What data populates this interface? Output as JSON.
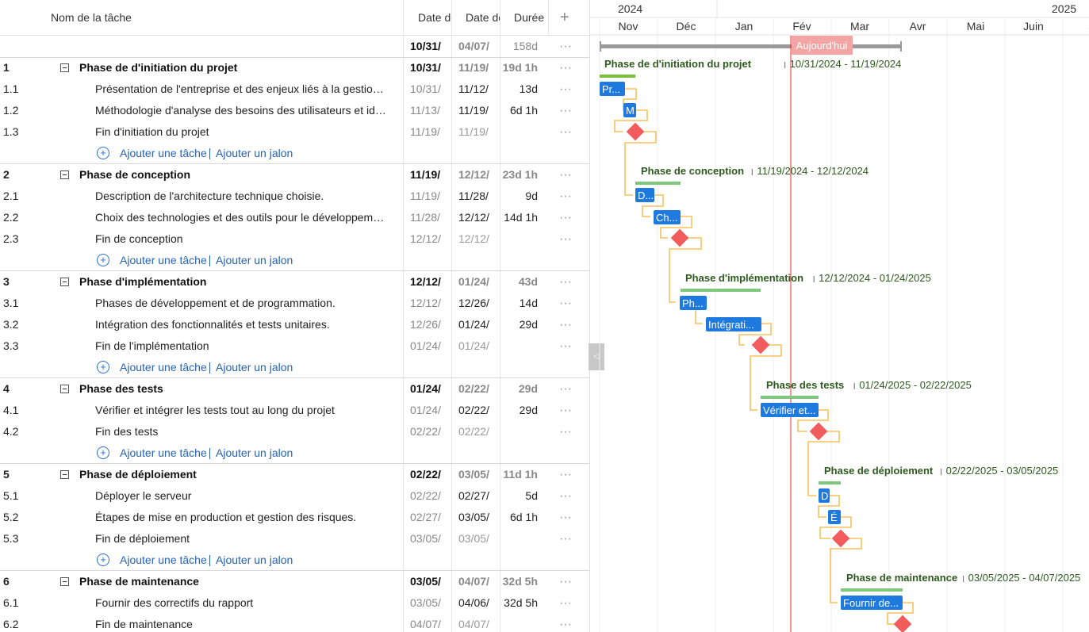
{
  "grid": {
    "headers": {
      "name": "Nom de la tâche",
      "start": "Date de",
      "end": "Date de",
      "duration": "Durée",
      "add": "+"
    },
    "summary": {
      "start": "10/31/",
      "end": "04/07/",
      "duration": "158d",
      "more": "···"
    },
    "add_task": "Ajouter une tâche",
    "add_milestone": "Ajouter un jalon",
    "more": "···",
    "rows": [
      {
        "type": "group",
        "wbs": "1",
        "name": "Phase de d'initiation du projet",
        "start": "10/31/",
        "end": "11/19/",
        "duration": "19d 1h"
      },
      {
        "type": "task",
        "wbs": "1.1",
        "name": "Présentation de l'entreprise et des enjeux liés à la gestion d...",
        "start": "10/31/",
        "end": "11/12/",
        "duration": "13d"
      },
      {
        "type": "task",
        "wbs": "1.2",
        "name": "Méthodologie d'analyse des besoins des utilisateurs et iden...",
        "start": "11/13/",
        "end": "11/19/",
        "duration": "6d 1h"
      },
      {
        "type": "task",
        "wbs": "1.3",
        "name": "Fin d'initiation du projet",
        "start": "11/19/",
        "end": "11/19/",
        "duration": ""
      },
      {
        "type": "add"
      },
      {
        "type": "group",
        "wbs": "2",
        "name": "Phase de conception",
        "start": "11/19/",
        "end": "12/12/",
        "duration": "23d 1h"
      },
      {
        "type": "task",
        "wbs": "2.1",
        "name": "Description de l'architecture technique choisie.",
        "start": "11/19/",
        "end": "11/28/",
        "duration": "9d"
      },
      {
        "type": "task",
        "wbs": "2.2",
        "name": "Choix des technologies et des outils pour le développement.",
        "start": "11/28/",
        "end": "12/12/",
        "duration": "14d 1h"
      },
      {
        "type": "task",
        "wbs": "2.3",
        "name": "Fin de conception",
        "start": "12/12/",
        "end": "12/12/",
        "duration": ""
      },
      {
        "type": "add"
      },
      {
        "type": "group",
        "wbs": "3",
        "name": "Phase d'implémentation",
        "start": "12/12/",
        "end": "01/24/",
        "duration": "43d"
      },
      {
        "type": "task",
        "wbs": "3.1",
        "name": "Phases de développement et de programmation.",
        "start": "12/12/",
        "end": "12/26/",
        "duration": "14d"
      },
      {
        "type": "task",
        "wbs": "3.2",
        "name": "Intégration des fonctionnalités et tests unitaires.",
        "start": "12/26/",
        "end": "01/24/",
        "duration": "29d"
      },
      {
        "type": "task",
        "wbs": "3.3",
        "name": "Fin de l'implémentation",
        "start": "01/24/",
        "end": "01/24/",
        "duration": ""
      },
      {
        "type": "add"
      },
      {
        "type": "group",
        "wbs": "4",
        "name": "Phase des tests",
        "start": "01/24/",
        "end": "02/22/",
        "duration": "29d"
      },
      {
        "type": "task",
        "wbs": "4.1",
        "name": "Vérifier et intégrer les tests tout au long du projet",
        "start": "01/24/",
        "end": "02/22/",
        "duration": "29d"
      },
      {
        "type": "task",
        "wbs": "4.2",
        "name": "Fin des tests",
        "start": "02/22/",
        "end": "02/22/",
        "duration": ""
      },
      {
        "type": "add"
      },
      {
        "type": "group",
        "wbs": "5",
        "name": "Phase de déploiement",
        "start": "02/22/",
        "end": "03/05/",
        "duration": "11d 1h"
      },
      {
        "type": "task",
        "wbs": "5.1",
        "name": "Déployer le serveur",
        "start": "02/22/",
        "end": "02/27/",
        "duration": "5d"
      },
      {
        "type": "task",
        "wbs": "5.2",
        "name": "Étapes de mise en production et gestion des risques.",
        "start": "02/27/",
        "end": "03/05/",
        "duration": "6d 1h"
      },
      {
        "type": "task",
        "wbs": "5.3",
        "name": "Fin de déploiement",
        "start": "03/05/",
        "end": "03/05/",
        "duration": ""
      },
      {
        "type": "add"
      },
      {
        "type": "group",
        "wbs": "6",
        "name": "Phase de maintenance",
        "start": "03/05/",
        "end": "04/07/",
        "duration": "32d 5h"
      },
      {
        "type": "task",
        "wbs": "6.1",
        "name": "Fournir des correctifs du rapport",
        "start": "03/05/",
        "end": "04/06/",
        "duration": "32d 5h"
      },
      {
        "type": "task",
        "wbs": "6.2",
        "name": "Fin de maintenance",
        "start": "04/07/",
        "end": "04/07/",
        "duration": ""
      }
    ]
  },
  "timeline": {
    "years": [
      "2024",
      "2025"
    ],
    "months": [
      "Nov",
      "Déc",
      "Jan",
      "Fév",
      "Mar",
      "Avr",
      "Mai",
      "Juin",
      "J"
    ],
    "today_label": "Aujourd'hui",
    "groups": [
      {
        "label": "Phase de d'initiation du projet",
        "range": "10/31/2024 - 11/19/2024"
      },
      {
        "label": "Phase de conception",
        "range": "11/19/2024 - 12/12/2024"
      },
      {
        "label": "Phase d'implémentation",
        "range": "12/12/2024 - 01/24/2025"
      },
      {
        "label": "Phase des tests",
        "range": "01/24/2025 - 02/22/2025"
      },
      {
        "label": "Phase de déploiement",
        "range": "02/22/2025 - 03/05/2025"
      },
      {
        "label": "Phase de maintenance",
        "range": "03/05/2025 - 04/07/2025"
      }
    ],
    "bar_labels": [
      "Pr...",
      "M",
      "D...",
      "Ch...",
      "Ph...",
      "Intégrati...",
      "Vérifier et...",
      "D",
      "É",
      "Fournir de..."
    ],
    "colors": {
      "task_bar": "#1f7ae0",
      "group_bar": "#7ec87e",
      "milestone": "#f25c5c",
      "today_line": "#e03030",
      "today_badge": "#f3a5a5",
      "dependency": "#f5c25b",
      "summary_bar": "#9a9a9a",
      "group_text": "#2d5a1d"
    }
  }
}
